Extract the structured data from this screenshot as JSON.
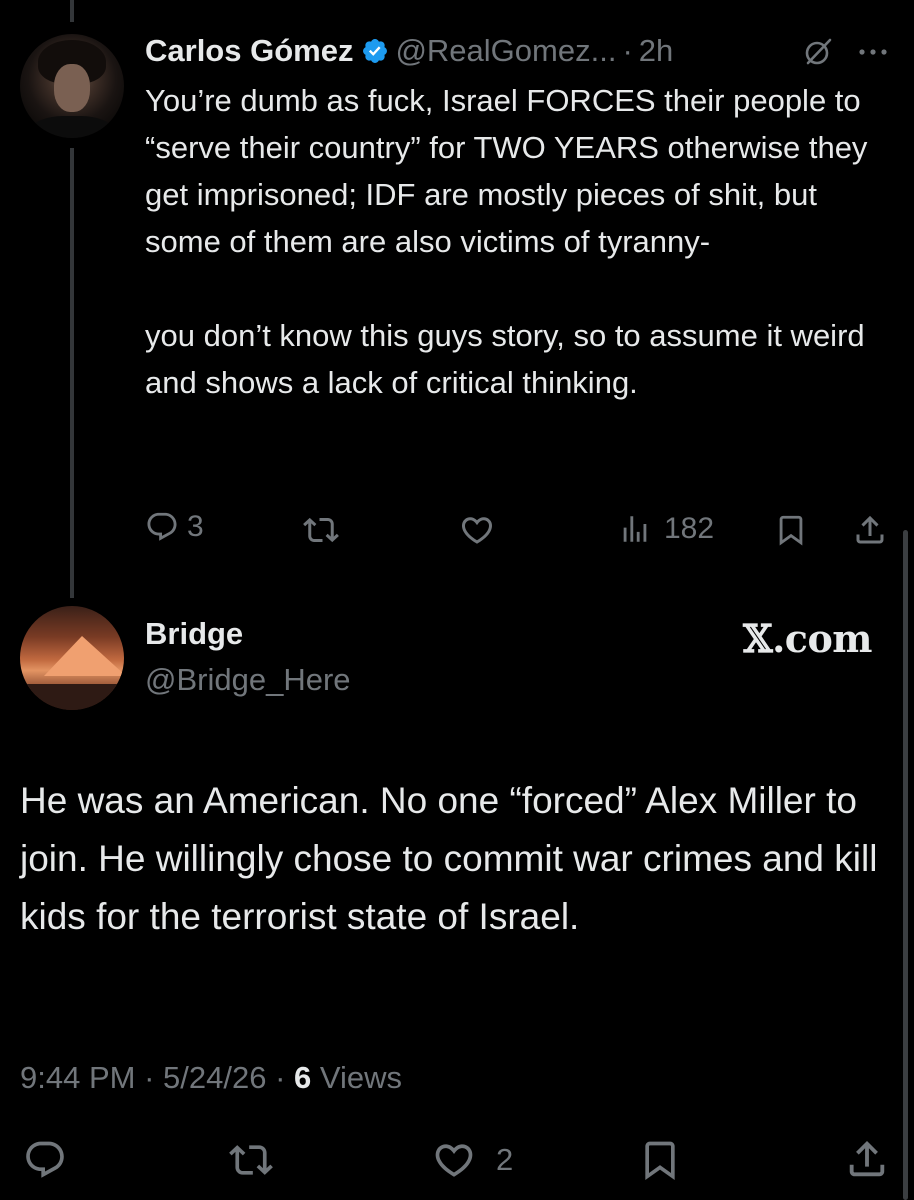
{
  "reply_tweet": {
    "author_name": "Carlos Gómez",
    "handle": "@RealGomez...",
    "separator": "·",
    "time": "2h",
    "paragraphs": [
      "You’re dumb as fuck, Israel FORCES their people to “serve their country” for TWO YEARS otherwise they get imprisoned; IDF are mostly pieces of shit, but some of them are also victims of tyranny-",
      "you don’t know this guys story, so to assume it weird and shows a lack of critical thinking."
    ],
    "replies": "3",
    "views": "182"
  },
  "main_tweet": {
    "author_name": "Bridge",
    "handle": "@Bridge_Here",
    "site_label": "𝕏.com",
    "text": "He was an American. No one “forced” Alex Miller to join. He willingly chose to commit war crimes and kill kids for the terrorist state of Israel.",
    "time": "9:44 PM",
    "sep1": " · ",
    "date": "5/24/26",
    "sep2": " · ",
    "views_count": "6",
    "views_label": " Views",
    "likes": "2"
  },
  "colors": {
    "background": "#000000",
    "text": "#e7e9ea",
    "muted": "#71767b",
    "verified": "#1d9bf0"
  },
  "icons": [
    "verified-badge-icon",
    "grok-icon",
    "more-icon",
    "reply-icon",
    "retweet-icon",
    "like-icon",
    "views-icon",
    "bookmark-icon",
    "share-icon"
  ]
}
